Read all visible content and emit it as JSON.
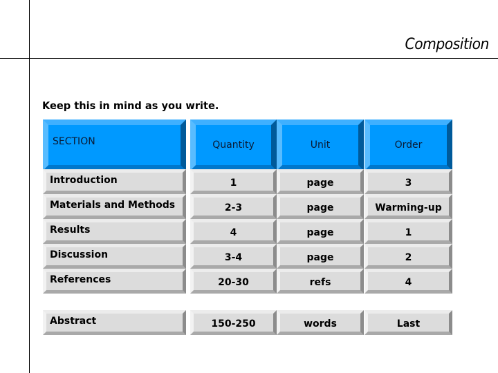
{
  "slide": {
    "title": "Composition",
    "subtitle": "Keep this in mind as you write."
  },
  "table": {
    "headers": [
      "SECTION",
      "Quantity",
      "Unit",
      "Order"
    ],
    "rows": [
      {
        "section": "Introduction",
        "quantity": "1",
        "unit": "page",
        "order": "3"
      },
      {
        "section": "Materials and Methods",
        "quantity": "2-3",
        "unit": "page",
        "order": "Warming-up"
      },
      {
        "section": "Results",
        "quantity": "4",
        "unit": "page",
        "order": "1"
      },
      {
        "section": "Discussion",
        "quantity": "3-4",
        "unit": "page",
        "order": "2"
      },
      {
        "section": "References",
        "quantity": "20-30",
        "unit": "refs",
        "order": "4"
      },
      {
        "section": "Abstract",
        "quantity": "150-250",
        "unit": "words",
        "order": "Last"
      }
    ]
  },
  "colors": {
    "header_face": "#0099ff",
    "body_face": "#dcdcdc"
  }
}
